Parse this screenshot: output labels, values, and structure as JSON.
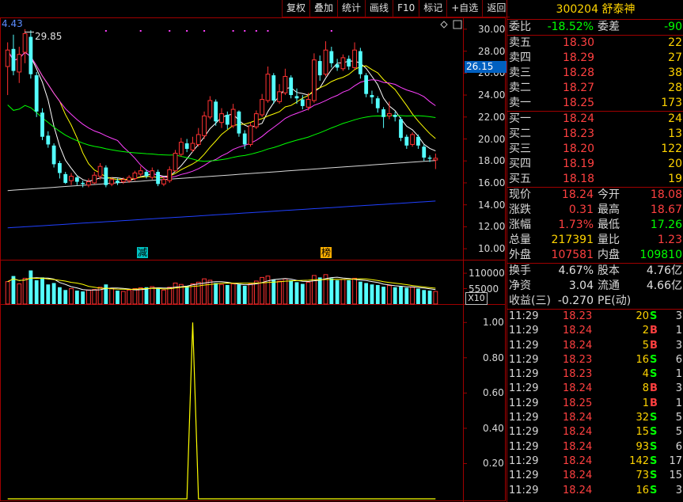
{
  "toolbar": {
    "items": [
      "复权",
      "叠加",
      "统计",
      "画线",
      "F10",
      "标记",
      "+自选",
      "返回"
    ]
  },
  "stock": {
    "code": "300204",
    "name": "舒泰神"
  },
  "commission": {
    "ratio_label": "委比",
    "ratio_value": "-18.52%",
    "diff_label": "委差",
    "diff_value": "-90"
  },
  "order_book": {
    "asks": [
      {
        "label": "卖五",
        "price": "18.30",
        "volume": "22"
      },
      {
        "label": "卖四",
        "price": "18.29",
        "volume": "27"
      },
      {
        "label": "卖三",
        "price": "18.28",
        "volume": "38"
      },
      {
        "label": "卖二",
        "price": "18.27",
        "volume": "28"
      },
      {
        "label": "卖一",
        "price": "18.25",
        "volume": "173"
      }
    ],
    "bids": [
      {
        "label": "买一",
        "price": "18.24",
        "volume": "24"
      },
      {
        "label": "买二",
        "price": "18.23",
        "volume": "13"
      },
      {
        "label": "买三",
        "price": "18.20",
        "volume": "122"
      },
      {
        "label": "买四",
        "price": "18.19",
        "volume": "20"
      },
      {
        "label": "买五",
        "price": "18.18",
        "volume": "19"
      }
    ]
  },
  "quote": {
    "price_label": "现价",
    "price": "18.24",
    "open_label": "今开",
    "open": "18.08",
    "change_label": "涨跌",
    "change": "0.31",
    "high_label": "最高",
    "high": "18.67",
    "pct_label": "涨幅",
    "pct": "1.73%",
    "low_label": "最低",
    "low": "17.26",
    "vol_label": "总量",
    "vol": "217391",
    "vr_label": "量比",
    "vr": "1.23",
    "outer_label": "外盘",
    "outer": "107581",
    "inner_label": "内盘",
    "inner": "109810",
    "turnover_label": "换手",
    "turnover": "4.67%",
    "shares_label": "股本",
    "shares": "4.76亿",
    "nav_label": "净资",
    "nav": "3.04",
    "float_label": "流通",
    "float": "4.66亿",
    "eps_label": "收益(三)",
    "eps": "-0.270",
    "pe_label": "PE(动)",
    "pe": ""
  },
  "trades": [
    {
      "time": "11:29",
      "price": "18.23",
      "vol": "20",
      "flag": "S",
      "n": "3"
    },
    {
      "time": "11:29",
      "price": "18.24",
      "vol": "2",
      "flag": "B",
      "n": "1"
    },
    {
      "time": "11:29",
      "price": "18.24",
      "vol": "5",
      "flag": "B",
      "n": "3"
    },
    {
      "time": "11:29",
      "price": "18.23",
      "vol": "16",
      "flag": "S",
      "n": "6"
    },
    {
      "time": "11:29",
      "price": "18.23",
      "vol": "4",
      "flag": "S",
      "n": "1"
    },
    {
      "time": "11:29",
      "price": "18.24",
      "vol": "8",
      "flag": "B",
      "n": "3"
    },
    {
      "time": "11:29",
      "price": "18.25",
      "vol": "1",
      "flag": "B",
      "n": "1"
    },
    {
      "time": "11:29",
      "price": "18.24",
      "vol": "32",
      "flag": "S",
      "n": "5"
    },
    {
      "time": "11:29",
      "price": "18.24",
      "vol": "15",
      "flag": "S",
      "n": "5"
    },
    {
      "time": "11:29",
      "price": "18.24",
      "vol": "93",
      "flag": "S",
      "n": "6"
    },
    {
      "time": "11:29",
      "price": "18.24",
      "vol": "142",
      "flag": "S",
      "n": "17"
    },
    {
      "time": "11:29",
      "price": "18.24",
      "vol": "73",
      "flag": "S",
      "n": "15"
    },
    {
      "time": "11:29",
      "price": "18.24",
      "vol": "16",
      "flag": "S",
      "n": "3"
    }
  ],
  "chart": {
    "top_left_value": "4.43",
    "peak_label": "29.85",
    "current_price_tag": "26.15",
    "price_ticks": [
      "30.00",
      "28.00",
      "26.00",
      "24.00",
      "22.00",
      "20.00",
      "18.00",
      "16.00",
      "14.00",
      "12.00",
      "10.00"
    ],
    "volume_ticks": [
      "110000",
      "55000"
    ],
    "volume_unit": "X10",
    "indicator_ticks": [
      "1.00",
      "0.80",
      "0.60",
      "0.40",
      "0.20"
    ],
    "markers": [
      "减",
      "榜"
    ],
    "colors": {
      "up": "#ff3232",
      "down": "#54ffff",
      "ma5": "#ffffff",
      "ma10": "#ffff00",
      "ma20": "#ff40ff",
      "ma60": "#00ff00",
      "ma120": "#d8d8d8",
      "ma250": "#2040ff",
      "grid": "#a00000"
    }
  },
  "chart_data": {
    "type": "candlestick",
    "price_range": [
      9,
      31
    ],
    "candles": [
      [
        26.6,
        28.1,
        24.0,
        28.8
      ],
      [
        28.2,
        26.2,
        25.8,
        29.5
      ],
      [
        26.1,
        27.7,
        25.1,
        28.4
      ],
      [
        27.9,
        29.6,
        26.9,
        30.0
      ],
      [
        29.3,
        25.9,
        25.5,
        29.9
      ],
      [
        25.8,
        22.5,
        22.0,
        26.1
      ],
      [
        22.4,
        20.2,
        19.9,
        22.8
      ],
      [
        20.3,
        19.5,
        19.2,
        20.7
      ],
      [
        19.4,
        17.7,
        17.4,
        19.6
      ],
      [
        17.8,
        16.9,
        16.4,
        18.0
      ],
      [
        16.8,
        16.0,
        15.9,
        17.0
      ],
      [
        16.2,
        16.6,
        15.8,
        16.9
      ],
      [
        16.5,
        16.1,
        15.8,
        16.7
      ],
      [
        16.0,
        15.9,
        15.6,
        16.2
      ],
      [
        15.8,
        16.1,
        15.6,
        16.4
      ],
      [
        16.0,
        16.7,
        15.9,
        17.0
      ],
      [
        16.6,
        17.5,
        16.3,
        17.8
      ],
      [
        17.4,
        15.8,
        15.6,
        17.6
      ],
      [
        15.9,
        16.3,
        15.7,
        16.5
      ],
      [
        16.2,
        16.0,
        15.8,
        16.4
      ],
      [
        16.1,
        16.3,
        15.9,
        16.5
      ],
      [
        16.2,
        16.5,
        16.0,
        16.7
      ],
      [
        16.4,
        16.9,
        16.2,
        17.1
      ],
      [
        16.8,
        17.1,
        16.6,
        17.5
      ],
      [
        17.0,
        16.6,
        16.4,
        17.2
      ],
      [
        16.5,
        17.1,
        16.3,
        17.4
      ],
      [
        17.0,
        15.9,
        15.7,
        17.2
      ],
      [
        15.9,
        16.3,
        15.7,
        16.5
      ],
      [
        16.2,
        17.2,
        16.0,
        17.5
      ],
      [
        17.1,
        18.7,
        17.0,
        19.0
      ],
      [
        18.6,
        19.7,
        18.4,
        20.1
      ],
      [
        19.6,
        19.1,
        18.8,
        20.0
      ],
      [
        19.0,
        19.6,
        18.8,
        20.2
      ],
      [
        19.5,
        20.4,
        19.3,
        21.0
      ],
      [
        20.3,
        22.1,
        20.0,
        22.5
      ],
      [
        22.0,
        23.5,
        21.8,
        23.9
      ],
      [
        23.4,
        21.6,
        21.2,
        23.6
      ],
      [
        21.5,
        22.3,
        21.0,
        22.8
      ],
      [
        22.2,
        21.3,
        20.9,
        22.5
      ],
      [
        21.2,
        22.7,
        21.0,
        23.2
      ],
      [
        22.5,
        20.5,
        20.2,
        22.6
      ],
      [
        20.5,
        19.5,
        19.1,
        20.8
      ],
      [
        19.5,
        21.2,
        19.3,
        21.5
      ],
      [
        21.1,
        22.3,
        20.9,
        22.6
      ],
      [
        22.2,
        23.6,
        22.0,
        24.1
      ],
      [
        23.5,
        25.9,
        23.3,
        26.6
      ],
      [
        25.8,
        23.5,
        23.2,
        26.0
      ],
      [
        23.4,
        24.3,
        23.2,
        25.0
      ],
      [
        24.2,
        25.7,
        24.0,
        26.4
      ],
      [
        25.6,
        24.0,
        23.7,
        25.8
      ],
      [
        23.9,
        23.7,
        23.2,
        24.6
      ],
      [
        23.6,
        23.0,
        22.7,
        24.0
      ],
      [
        22.9,
        23.6,
        22.6,
        24.2
      ],
      [
        23.5,
        27.2,
        23.3,
        27.8
      ],
      [
        27.1,
        25.8,
        25.3,
        27.6
      ],
      [
        25.9,
        28.1,
        25.7,
        28.9
      ],
      [
        28.0,
        26.9,
        26.5,
        28.4
      ],
      [
        26.8,
        26.5,
        26.2,
        27.3
      ],
      [
        26.4,
        27.4,
        26.2,
        27.7
      ],
      [
        27.3,
        26.6,
        26.3,
        27.6
      ],
      [
        26.5,
        28.1,
        26.3,
        28.8
      ],
      [
        28.0,
        25.9,
        25.5,
        28.3
      ],
      [
        25.8,
        24.1,
        23.8,
        26.0
      ],
      [
        24.0,
        23.8,
        23.2,
        24.4
      ],
      [
        23.7,
        22.8,
        22.4,
        23.9
      ],
      [
        22.7,
        22.0,
        21.0,
        22.9
      ],
      [
        22.1,
        22.3,
        21.8,
        23.4
      ],
      [
        22.2,
        22.0,
        21.6,
        22.5
      ],
      [
        21.8,
        20.1,
        19.8,
        22.0
      ],
      [
        20.2,
        19.4,
        19.1,
        20.4
      ],
      [
        19.5,
        20.4,
        19.3,
        20.6
      ],
      [
        20.2,
        19.4,
        19.1,
        20.4
      ],
      [
        19.3,
        18.3,
        18.0,
        19.5
      ],
      [
        18.3,
        18.2,
        17.9,
        18.5
      ],
      [
        18.08,
        18.24,
        17.26,
        18.67
      ]
    ],
    "volumes": [
      80,
      100,
      72,
      92,
      120,
      85,
      95,
      70,
      75,
      60,
      50,
      55,
      48,
      45,
      50,
      52,
      60,
      70,
      55,
      48,
      45,
      50,
      55,
      58,
      60,
      62,
      55,
      50,
      60,
      75,
      70,
      65,
      72,
      78,
      90,
      85,
      75,
      70,
      68,
      72,
      70,
      65,
      72,
      82,
      95,
      100,
      88,
      82,
      90,
      85,
      78,
      72,
      78,
      102,
      95,
      105,
      92,
      85,
      88,
      85,
      92,
      80,
      75,
      70,
      68,
      62,
      66,
      60,
      62,
      58,
      60,
      55,
      50,
      48,
      45
    ],
    "indicator_peak": {
      "index": 32,
      "value": 1.0
    },
    "indicator_range": [
      0,
      1.1
    ]
  }
}
